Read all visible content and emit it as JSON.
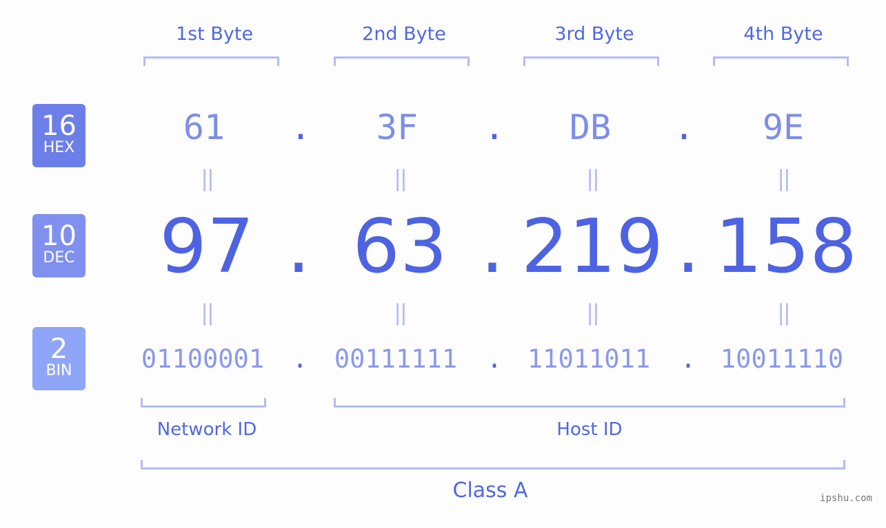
{
  "bytes": [
    {
      "label": "1st Byte",
      "hex": "61",
      "dec": "97",
      "bin": "01100001"
    },
    {
      "label": "2nd Byte",
      "hex": "3F",
      "dec": "63",
      "bin": "00111111"
    },
    {
      "label": "3rd Byte",
      "hex": "DB",
      "dec": "219",
      "bin": "11011011"
    },
    {
      "label": "4th Byte",
      "hex": "9E",
      "dec": "158",
      "bin": "10011110"
    }
  ],
  "badges": {
    "hex": {
      "num": "16",
      "label": "HEX",
      "color": "#6c7ee7"
    },
    "dec": {
      "num": "10",
      "label": "DEC",
      "color": "#8090ee"
    },
    "bin": {
      "num": "2",
      "label": "BIN",
      "color": "#8fa6f8"
    }
  },
  "separator": ".",
  "equals": "||",
  "network_id": "Network ID",
  "host_id": "Host ID",
  "ip_class": "Class A",
  "watermark": "ipshu.com"
}
